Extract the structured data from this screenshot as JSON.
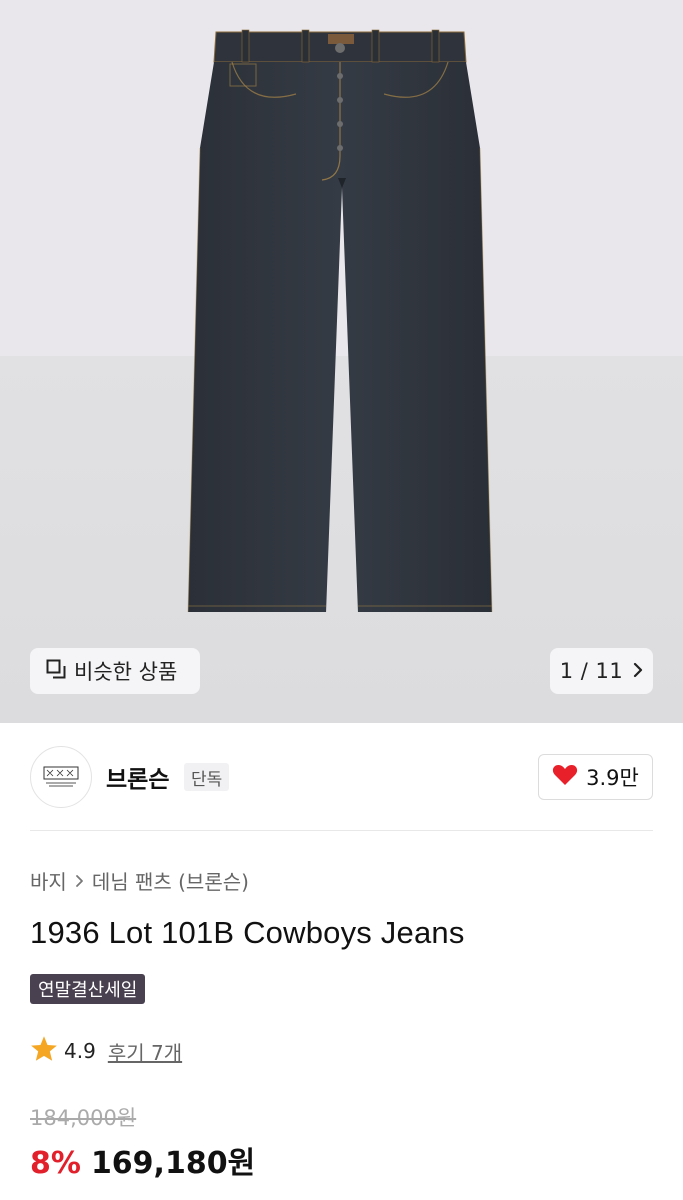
{
  "gallery": {
    "similar_label": "비슷한 상품",
    "counter": "1 / 11"
  },
  "brand": {
    "name": "브론슨",
    "exclusive_badge": "단독",
    "likes": "3.9만"
  },
  "product": {
    "category": "바지",
    "subcategory": "데님 팬츠 (브론슨)",
    "title": "1936 Lot 101B Cowboys Jeans",
    "sale_badge": "연말결산세일",
    "rating": "4.9",
    "review_link": "후기 7개",
    "original_price": "184,000원",
    "discount_rate": "8%",
    "sale_price": "169,180원"
  },
  "colors": {
    "accent_red": "#e1202b",
    "sale_badge_bg": "#4a4150",
    "star": "#f5a623",
    "heart": "#e8202a"
  },
  "icons": {
    "similar": "overlapping-squares-icon",
    "counter": "chevron-right-icon",
    "breadcrumb": "chevron-right-icon",
    "like": "heart-icon",
    "rating": "star-icon"
  }
}
